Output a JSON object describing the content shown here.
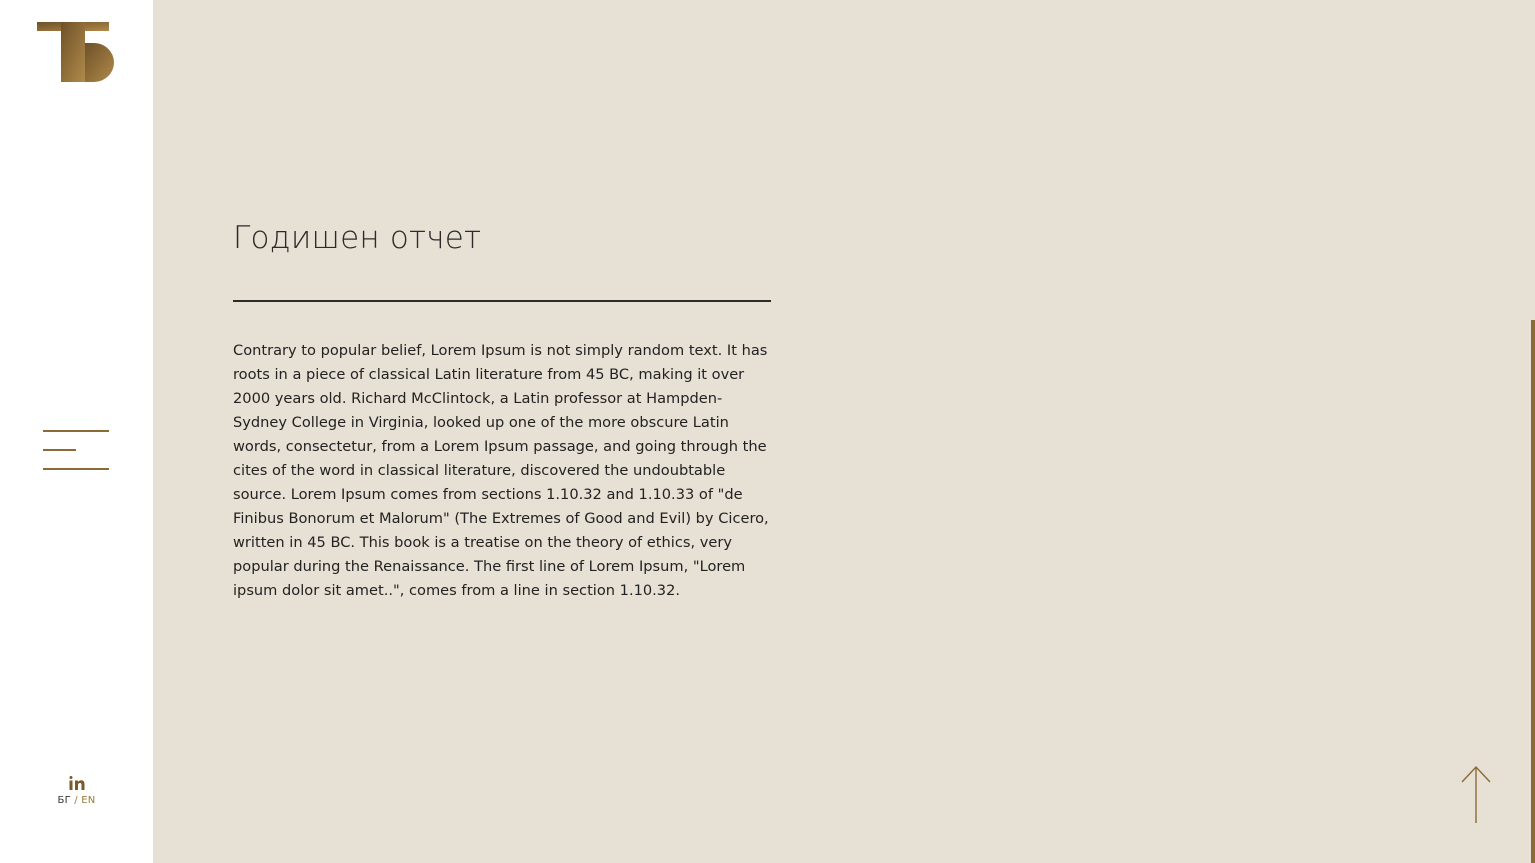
{
  "sidebar": {
    "logo_alt": "logo-mark",
    "menu_icon": "hamburger-menu-icon",
    "social": {
      "linkedin_icon": "linkedin-icon"
    },
    "language": {
      "bg": "БГ",
      "separator": "/",
      "en": "EN"
    }
  },
  "main": {
    "title": "Годишен отчет",
    "body": "Contrary to popular belief, Lorem Ipsum is not simply random text. It has roots in a piece of classical Latin literature from 45 BC, making it over 2000 years old. Richard McClintock, a Latin professor at Hampden-Sydney College in Virginia, looked up one of the more obscure Latin words, consectetur, from a Lorem Ipsum passage, and going through the cites of the word in classical literature, discovered the undoubtable source. Lorem Ipsum comes from sections 1.10.32 and 1.10.33 of \"de Finibus Bonorum et Malorum\" (The Extremes of Good and Evil) by Cicero, written in 45 BC. This book is a treatise on the theory of ethics, very popular during the Renaissance. The first line of Lorem Ipsum, \"Lorem ipsum dolor sit amet..\", comes from a line in section 1.10.32.",
    "back_to_top_icon": "arrow-up-icon"
  },
  "colors": {
    "accent": "#8a6a35",
    "sidebar_bg": "#ffffff",
    "main_bg": "#e7e0d5",
    "text": "#222222"
  }
}
